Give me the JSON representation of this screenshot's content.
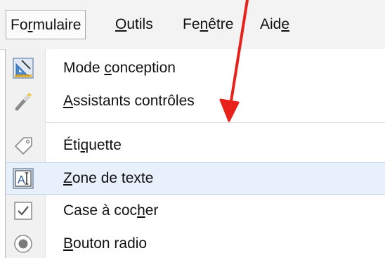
{
  "menubar": {
    "items": [
      {
        "pre": "Fo",
        "mn": "r",
        "post": "mulaire"
      },
      {
        "pre": "",
        "mn": "O",
        "post": "utils"
      },
      {
        "pre": "Fe",
        "mn": "n",
        "post": "être"
      },
      {
        "pre": "Aid",
        "mn": "e",
        "post": ""
      }
    ]
  },
  "menu": {
    "items": [
      {
        "pre": "Mode ",
        "mn": "c",
        "post": "onception",
        "icon": "design-mode-icon"
      },
      {
        "pre": "",
        "mn": "A",
        "post": "ssistants contrôles",
        "icon": "wizard-wand-icon"
      },
      {
        "pre": "Éti",
        "mn": "q",
        "post": "uette",
        "icon": "label-tag-icon"
      },
      {
        "pre": "",
        "mn": "Z",
        "post": "one de texte",
        "icon": "text-box-icon"
      },
      {
        "pre": "Case à coc",
        "mn": "h",
        "post": "er",
        "icon": "checkbox-icon"
      },
      {
        "pre": "",
        "mn": "B",
        "post": "outon radio",
        "icon": "radio-button-icon"
      }
    ]
  },
  "colors": {
    "highlight": "#e8f0fb",
    "arrow": "#e8211b",
    "icon_blue": "#2f6db3"
  }
}
